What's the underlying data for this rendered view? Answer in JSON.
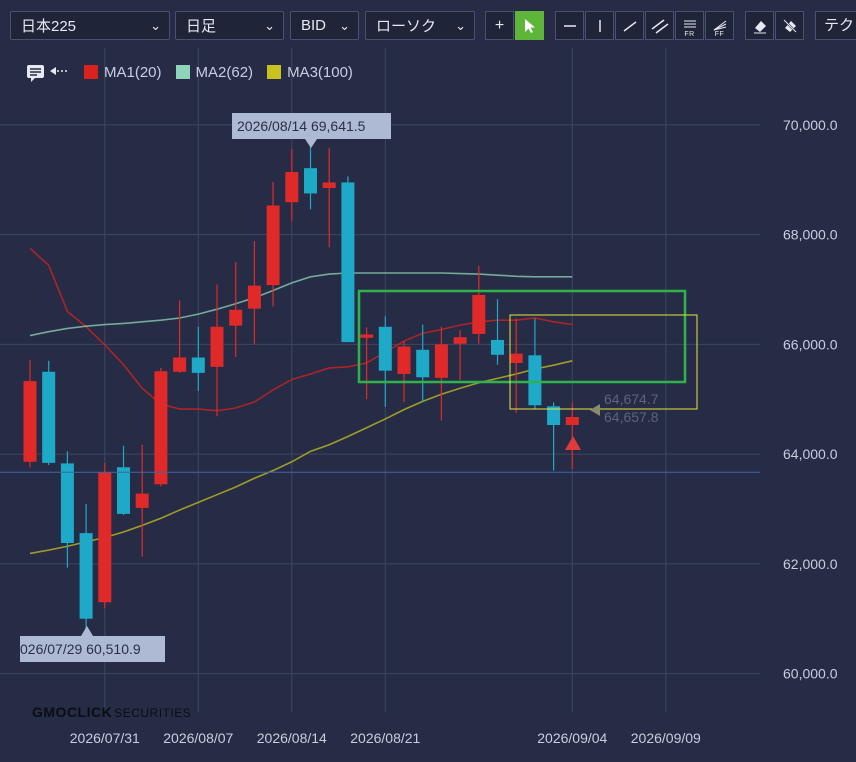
{
  "toolbar": {
    "symbol": "日本225",
    "period": "日足",
    "price_type": "BID",
    "chart_style": "ローソク",
    "tech_label": "テク",
    "tool_sub_fr": "FR",
    "tool_sub_ff": "FF"
  },
  "legend": [
    {
      "label": "MA1(20)",
      "color": "#d9221e"
    },
    {
      "label": "MA2(62)",
      "color": "#8fd4b8"
    },
    {
      "label": "MA3(100)",
      "color": "#c9c21c"
    }
  ],
  "callouts": {
    "high": "2026/08/14 69,641.5",
    "low": "026/07/29 60,510.9",
    "price1": "64,674.7",
    "price2": "64,657.8"
  },
  "branding": {
    "name": "GMOCLICK",
    "suffix": "SECURITIES"
  },
  "colors": {
    "up": "#e02a2a",
    "down": "#1fa9c9",
    "grid": "#3e4560",
    "green_box": "#2fb24a",
    "yellow_box": "#e6e63a",
    "current_line": "#3f66a8"
  },
  "chart_data": {
    "type": "candlestick",
    "x_tick_labels": [
      "2026/07/31",
      "2026/08/07",
      "2026/08/14",
      "2026/08/21",
      "2026/09/04",
      "2026/09/09"
    ],
    "y_tick_labels": [
      "70,000.0",
      "68,000.0",
      "66,000.0",
      "64,000.0",
      "62,000.0",
      "60,000.0"
    ],
    "ylim": [
      59300,
      71400
    ],
    "current_price": 63670,
    "candles": [
      {
        "o": 63860,
        "c": 65330,
        "h": 65710,
        "l": 63760
      },
      {
        "o": 65500,
        "c": 63840,
        "h": 65700,
        "l": 63800
      },
      {
        "o": 63830,
        "c": 62380,
        "h": 64050,
        "l": 61930
      },
      {
        "o": 62560,
        "c": 61000,
        "h": 63090,
        "l": 60510
      },
      {
        "o": 61300,
        "c": 63670,
        "h": 63840,
        "l": 61190
      },
      {
        "o": 63760,
        "c": 62910,
        "h": 64150,
        "l": 62890
      },
      {
        "o": 63020,
        "c": 63280,
        "h": 64170,
        "l": 62130
      },
      {
        "o": 63450,
        "c": 65510,
        "h": 65570,
        "l": 63410
      },
      {
        "o": 65500,
        "c": 65760,
        "h": 66800,
        "l": 65480
      },
      {
        "o": 65760,
        "c": 65480,
        "h": 66320,
        "l": 65150
      },
      {
        "o": 65590,
        "c": 66320,
        "h": 67090,
        "l": 64690
      },
      {
        "o": 66340,
        "c": 66630,
        "h": 67500,
        "l": 65770
      },
      {
        "o": 66650,
        "c": 67070,
        "h": 67880,
        "l": 66000
      },
      {
        "o": 67080,
        "c": 68530,
        "h": 68960,
        "l": 66690
      },
      {
        "o": 68590,
        "c": 69140,
        "h": 69560,
        "l": 68240
      },
      {
        "o": 69210,
        "c": 68750,
        "h": 69640,
        "l": 68460
      },
      {
        "o": 68850,
        "c": 68950,
        "h": 69580,
        "l": 67770
      },
      {
        "o": 68950,
        "c": 66040,
        "h": 69060,
        "l": 66040
      },
      {
        "o": 66120,
        "c": 66180,
        "h": 66310,
        "l": 65000
      },
      {
        "o": 66320,
        "c": 65520,
        "h": 66510,
        "l": 64860
      },
      {
        "o": 65460,
        "c": 65960,
        "h": 66060,
        "l": 64950
      },
      {
        "o": 65900,
        "c": 65400,
        "h": 66360,
        "l": 64950
      },
      {
        "o": 65390,
        "c": 66000,
        "h": 66320,
        "l": 64610
      },
      {
        "o": 66010,
        "c": 66130,
        "h": 66260,
        "l": 65350
      },
      {
        "o": 66190,
        "c": 66900,
        "h": 67430,
        "l": 66010
      },
      {
        "o": 66080,
        "c": 65810,
        "h": 66820,
        "l": 65630
      },
      {
        "o": 65660,
        "c": 65830,
        "h": 66470,
        "l": 64750
      },
      {
        "o": 65800,
        "c": 64890,
        "h": 66470,
        "l": 64810
      },
      {
        "o": 64870,
        "c": 64530,
        "h": 64940,
        "l": 63700
      },
      {
        "o": 64530,
        "c": 64675,
        "h": 64940,
        "l": 63730
      }
    ],
    "series": [
      {
        "name": "MA1(20)",
        "values": [
          67750,
          67440,
          66600,
          66320,
          65990,
          65630,
          65200,
          64910,
          64820,
          64820,
          64790,
          64840,
          64950,
          65170,
          65360,
          65460,
          65570,
          65590,
          65660,
          65860,
          66060,
          66200,
          66270,
          66350,
          66410,
          66440,
          66440,
          66480,
          66410,
          66360
        ]
      },
      {
        "name": "MA2(62)",
        "values": [
          66160,
          66230,
          66290,
          66330,
          66360,
          66380,
          66410,
          66440,
          66480,
          66550,
          66640,
          66740,
          66850,
          66980,
          67120,
          67230,
          67280,
          67300,
          67300,
          67300,
          67300,
          67300,
          67300,
          67290,
          67280,
          67260,
          67240,
          67230,
          67230,
          67230
        ]
      },
      {
        "name": "MA3(100)",
        "values": [
          62190,
          62250,
          62320,
          62400,
          62480,
          62580,
          62700,
          62830,
          62980,
          63120,
          63260,
          63400,
          63560,
          63700,
          63860,
          64050,
          64170,
          64320,
          64480,
          64640,
          64810,
          64960,
          65090,
          65200,
          65300,
          65380,
          65460,
          65550,
          65620,
          65700
        ]
      }
    ]
  }
}
